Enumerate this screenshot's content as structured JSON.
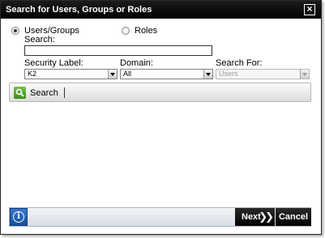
{
  "dialog": {
    "title": "Search for Users, Groups or Roles"
  },
  "scope": {
    "users_groups_label": "Users/Groups",
    "roles_label": "Roles",
    "selected": "Users/Groups"
  },
  "search": {
    "label": "Search:",
    "value": "",
    "placeholder": ""
  },
  "filters": {
    "security_label": {
      "label": "Security Label:",
      "value": "K2"
    },
    "domain": {
      "label": "Domain:",
      "value": "All"
    },
    "search_for": {
      "label": "Search For:",
      "value": "Users",
      "disabled": true
    }
  },
  "toolbar": {
    "search_button_label": "Search",
    "search_icon": "magnifier-icon"
  },
  "footer": {
    "info_icon": "info-icon",
    "next_label": "Next",
    "cancel_label": "Cancel"
  },
  "colors": {
    "titlebar": "#000000",
    "info_blue": "#2a64b6",
    "search_icon_green": "#4f9d2a"
  }
}
